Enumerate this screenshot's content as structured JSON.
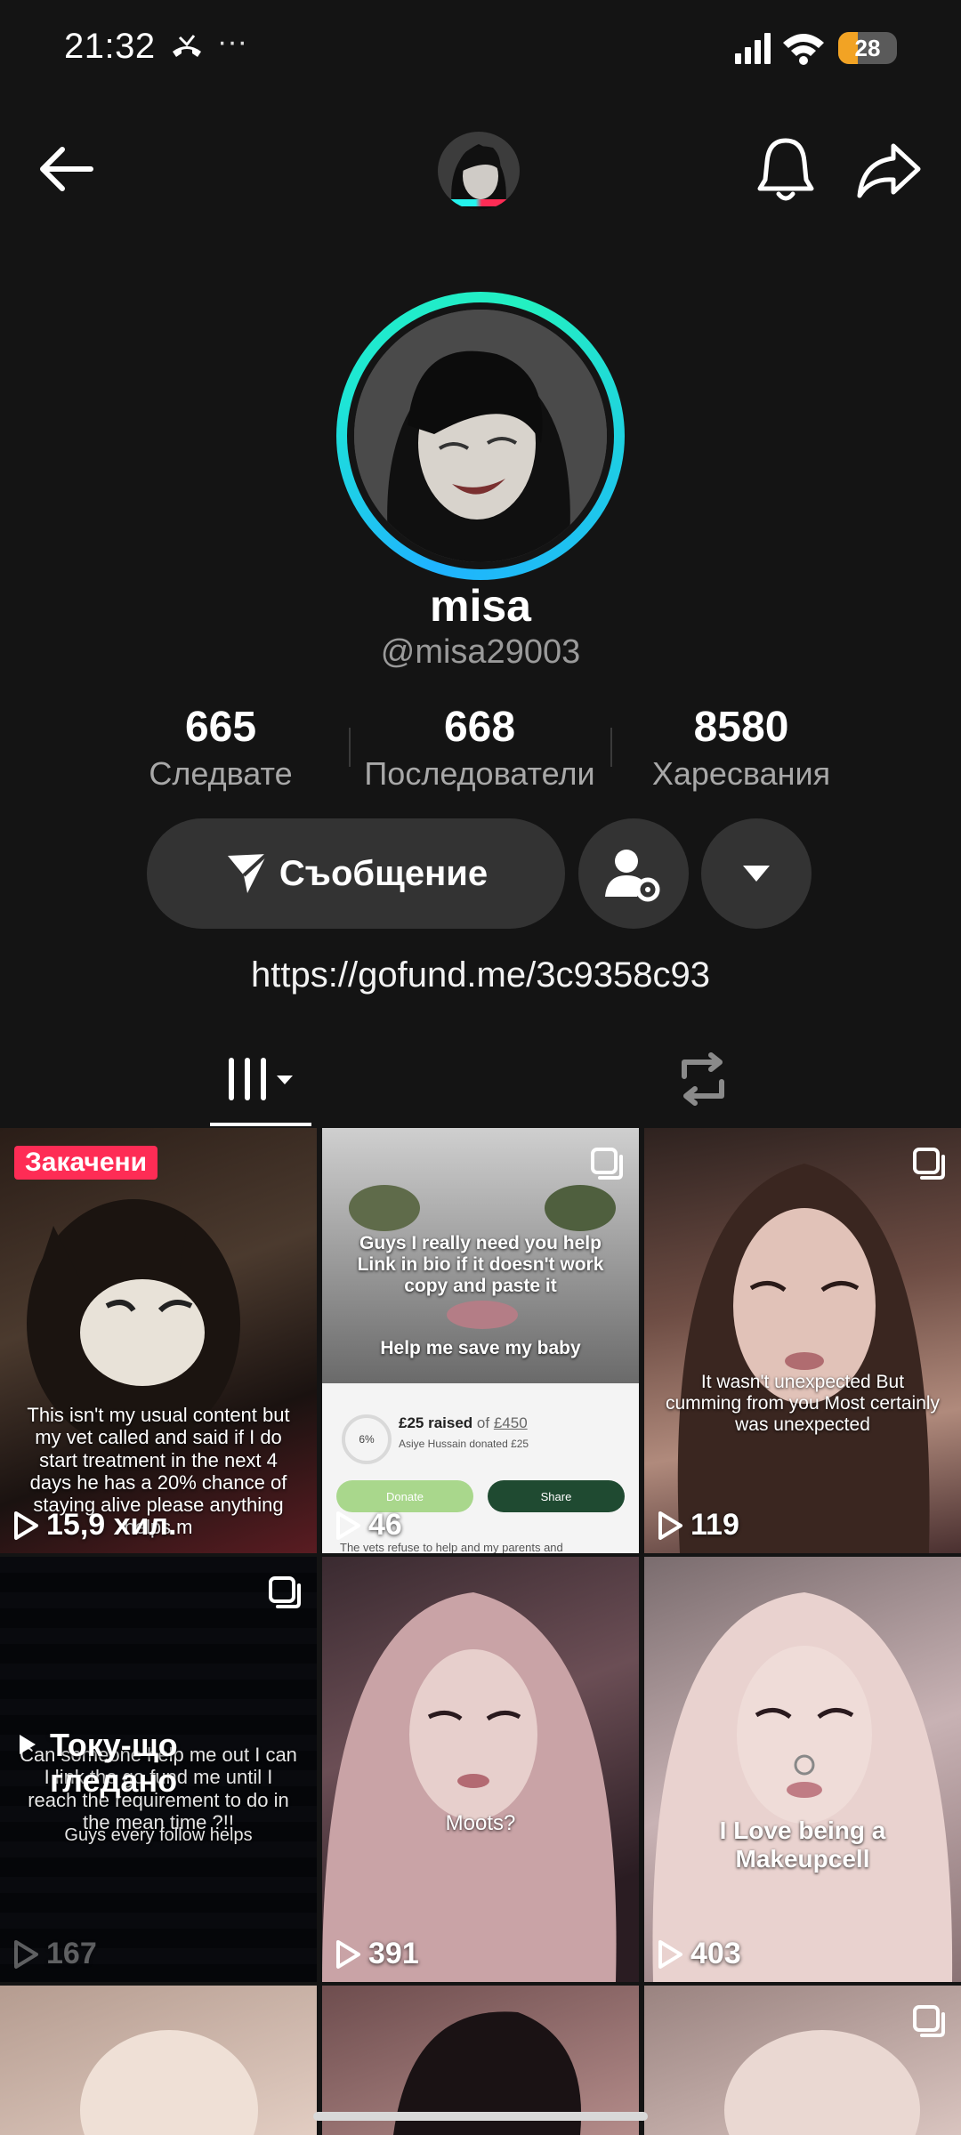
{
  "status_bar": {
    "time": "21:32",
    "extra": "···",
    "battery": "28"
  },
  "profile": {
    "display_name": "misa",
    "username": "@misa29003",
    "stats": [
      {
        "value": "665",
        "label": "Следвате"
      },
      {
        "value": "668",
        "label": "Последователи"
      },
      {
        "value": "8580",
        "label": "Харесвания"
      }
    ],
    "message_label": "Съобщение",
    "bio_link": "https://gofund.me/3c9358c93"
  },
  "grid": {
    "pinned_label": "Закачени",
    "watched_label": "Току-що гледано",
    "items": [
      {
        "views": "15,9 хил.",
        "caption": "This isn't my usual content but my vet called and said if I do start treatment in the next 4 days he has a 20% chance of staying alive please anything helps m"
      },
      {
        "views": "46",
        "caption": "Guys I really need you help Link in bio if it doesn't work copy and paste it",
        "caption2": "Help me save my baby",
        "fund": {
          "raised": "£25 raised",
          "goal_prefix": "of",
          "goal": "£450",
          "donor": "Asiye Hussain donated £25",
          "percent": "6%",
          "donate": "Donate",
          "share": "Share",
          "footer": "The vets refuse to help and my parents and"
        }
      },
      {
        "views": "119",
        "caption": "It wasn't unexpected But cumming from you Most certainly was unexpected"
      },
      {
        "views": "167",
        "caption": "Guys every follow helps",
        "caption_mid": "Can someone help me out I can I link the go fund me until I reach the requirement to do in the mean time ?!!"
      },
      {
        "views": "391",
        "caption": "Moots?"
      },
      {
        "views": "403",
        "caption": "I Love being a Makeupcell"
      }
    ]
  },
  "colors": {
    "accent": "#fe2c55",
    "ring_start": "#1fb3ff",
    "ring_end": "#23f0c1",
    "button_bg": "#333333"
  }
}
